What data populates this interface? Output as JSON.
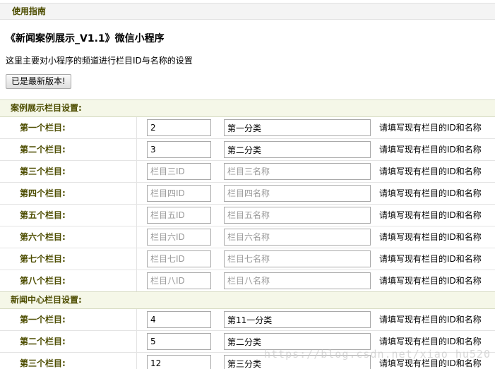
{
  "header": {
    "guide_title": "使用指南"
  },
  "intro": {
    "app_title": "《新闻案例展示_V1.1》微信小程序",
    "description": "这里主要对小程序的频道进行栏目ID与名称的设置",
    "version_button": "已是最新版本!"
  },
  "sections": [
    {
      "title": "案例展示栏目设置:",
      "rows": [
        {
          "label": "第一个栏目:",
          "id_value": "2",
          "id_placeholder": "",
          "name_value": "第一分类",
          "name_placeholder": "",
          "hint": "请填写现有栏目的ID和名称"
        },
        {
          "label": "第二个栏目:",
          "id_value": "3",
          "id_placeholder": "",
          "name_value": "第二分类",
          "name_placeholder": "",
          "hint": "请填写现有栏目的ID和名称"
        },
        {
          "label": "第三个栏目:",
          "id_value": "",
          "id_placeholder": "栏目三ID",
          "name_value": "",
          "name_placeholder": "栏目三名称",
          "hint": "请填写现有栏目的ID和名称"
        },
        {
          "label": "第四个栏目:",
          "id_value": "",
          "id_placeholder": "栏目四ID",
          "name_value": "",
          "name_placeholder": "栏目四名称",
          "hint": "请填写现有栏目的ID和名称"
        },
        {
          "label": "第五个栏目:",
          "id_value": "",
          "id_placeholder": "栏目五ID",
          "name_value": "",
          "name_placeholder": "栏目五名称",
          "hint": "请填写现有栏目的ID和名称"
        },
        {
          "label": "第六个栏目:",
          "id_value": "",
          "id_placeholder": "栏目六ID",
          "name_value": "",
          "name_placeholder": "栏目六名称",
          "hint": "请填写现有栏目的ID和名称"
        },
        {
          "label": "第七个栏目:",
          "id_value": "",
          "id_placeholder": "栏目七ID",
          "name_value": "",
          "name_placeholder": "栏目七名称",
          "hint": "请填写现有栏目的ID和名称"
        },
        {
          "label": "第八个栏目:",
          "id_value": "",
          "id_placeholder": "栏目八ID",
          "name_value": "",
          "name_placeholder": "栏目八名称",
          "hint": "请填写现有栏目的ID和名称"
        }
      ]
    },
    {
      "title": "新闻中心栏目设置:",
      "rows": [
        {
          "label": "第一个栏目:",
          "id_value": "4",
          "id_placeholder": "",
          "name_value": "第11一分类",
          "name_placeholder": "",
          "hint": "请填写现有栏目的ID和名称"
        },
        {
          "label": "第二个栏目:",
          "id_value": "5",
          "id_placeholder": "",
          "name_value": "第二分类",
          "name_placeholder": "",
          "hint": "请填写现有栏目的ID和名称"
        },
        {
          "label": "第三个栏目:",
          "id_value": "12",
          "id_placeholder": "",
          "name_value": "第三分类",
          "name_placeholder": "",
          "hint": "请填写现有栏目的ID和名称"
        }
      ]
    }
  ],
  "watermark": "https://blog.csdn.net/xiao_hu520"
}
